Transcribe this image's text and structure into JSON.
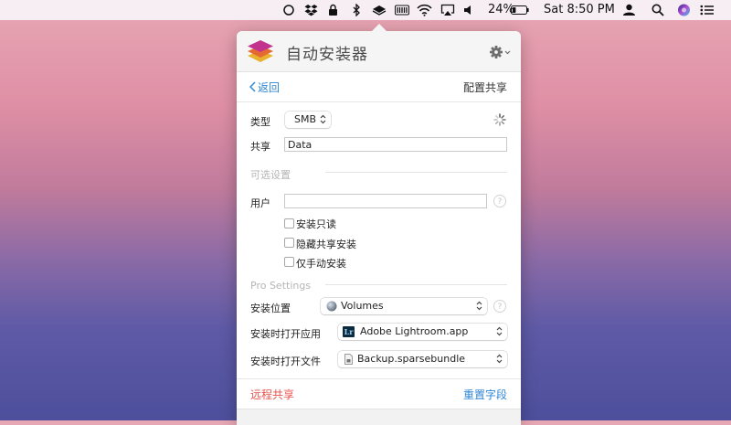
{
  "menubar": {
    "battery_percent": "24%",
    "battery_level": 0.24,
    "clock": "Sat 8:50 PM"
  },
  "panel": {
    "app_title": "自动安装器",
    "back_label": "返回",
    "page_heading": "配置共享",
    "type_label": "类型",
    "type_value": "SMB",
    "share_label": "共享",
    "share_value": "Data",
    "optional_section": "可选设置",
    "user_label": "用户",
    "user_value": "",
    "help_glyph": "?",
    "checkboxes": [
      {
        "label": "安装只读",
        "checked": false
      },
      {
        "label": "隐藏共享安装",
        "checked": false
      },
      {
        "label": "仅手动安装",
        "checked": false
      }
    ],
    "pro_section": "Pro Settings",
    "mount_location_label": "安装位置",
    "mount_location_value": "Volumes",
    "open_app_label": "安装时打开应用",
    "open_app_value": "Adobe Lightroom.app",
    "open_app_icon_text": "Lr",
    "open_file_label": "安装时打开文件",
    "open_file_value": "Backup.sparsebundle",
    "remote_share_link": "远程共享",
    "reset_fields_link": "重置字段",
    "colors": {
      "accent_blue": "#2f86d6",
      "remote_red": "#e8534e",
      "lightroom_bg": "#0b2a3f"
    }
  }
}
